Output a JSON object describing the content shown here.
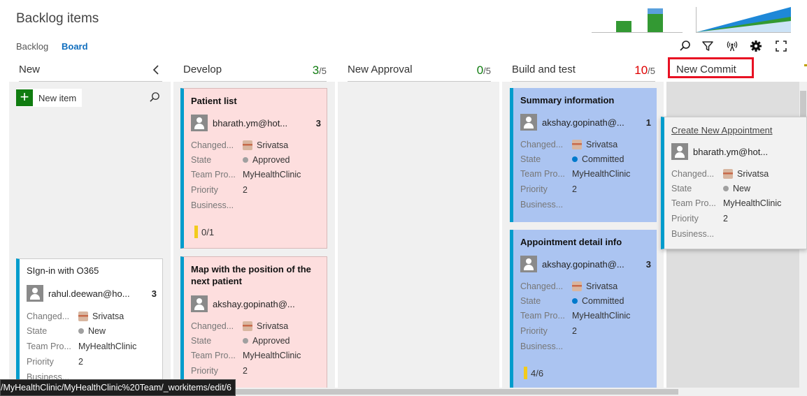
{
  "header": {
    "title": "Backlog items",
    "tabs": {
      "backlog": "Backlog",
      "board": "Board"
    }
  },
  "columns": [
    {
      "name": "New",
      "count": "",
      "limit": "",
      "count_color": "#107c10"
    },
    {
      "name": "Develop",
      "count": "3",
      "limit": "/5",
      "count_color": "#107c10"
    },
    {
      "name": "New Approval",
      "count": "0",
      "limit": "/5",
      "count_color": "#107c10"
    },
    {
      "name": "Build and test",
      "count": "10",
      "limit": "/5",
      "count_color": "#e00000"
    },
    {
      "name": "New Commit",
      "count": "",
      "limit": ""
    }
  ],
  "new_column": {
    "new_item_label": "New item"
  },
  "field_labels": {
    "changed": "Changed...",
    "state": "State",
    "team_project": "Team Pro...",
    "priority": "Priority",
    "business": "Business..."
  },
  "cards": {
    "signin": {
      "title": "SIgn-in with O365",
      "assignee": "rahul.deewan@ho...",
      "effort": "3",
      "changed_by": "Srivatsa",
      "state": "New",
      "state_color": "#a0a0a0",
      "team_project": "MyHealthClinic",
      "priority": "2"
    },
    "patient_list": {
      "title": "Patient list",
      "assignee": "bharath.ym@hot...",
      "effort": "3",
      "changed_by": "Srivatsa",
      "state": "Approved",
      "state_color": "#a0a0a0",
      "team_project": "MyHealthClinic",
      "priority": "2",
      "tasks": "0/1"
    },
    "map": {
      "title": "Map with the position of the next patient",
      "assignee": "akshay.gopinath@...",
      "changed_by": "Srivatsa",
      "state": "Approved",
      "state_color": "#a0a0a0",
      "team_project": "MyHealthClinic",
      "priority": "2"
    },
    "summary": {
      "title": "Summary information",
      "assignee": "akshay.gopinath@...",
      "effort": "1",
      "changed_by": "Srivatsa",
      "state": "Committed",
      "state_color": "#007acc",
      "team_project": "MyHealthClinic",
      "priority": "2"
    },
    "appointment": {
      "title": "Appointment detail info",
      "assignee": "akshay.gopinath@...",
      "effort": "3",
      "changed_by": "Srivatsa",
      "state": "Committed",
      "state_color": "#007acc",
      "team_project": "MyHealthClinic",
      "priority": "2",
      "tasks": "4/6"
    },
    "create_appointment": {
      "title": "Create New Appointment",
      "assignee": "bharath.ym@hot...",
      "changed_by": "Srivatsa",
      "state": "New",
      "state_color": "#a0a0a0",
      "team_project": "MyHealthClinic",
      "priority": "2"
    }
  },
  "status_bar": {
    "url": "/MyHealthClinic/MyHealthClinic%20Team/_workitems/edit/6"
  },
  "colors": {
    "accent": "#106ebe",
    "card_border": "#009ccc",
    "highlight": "#e81123"
  },
  "icons": [
    "search-icon",
    "filter-icon",
    "live-updates-icon",
    "settings-gear-icon",
    "fullscreen-icon",
    "collapse-chevron-icon",
    "plus-icon",
    "person-avatar-icon"
  ]
}
